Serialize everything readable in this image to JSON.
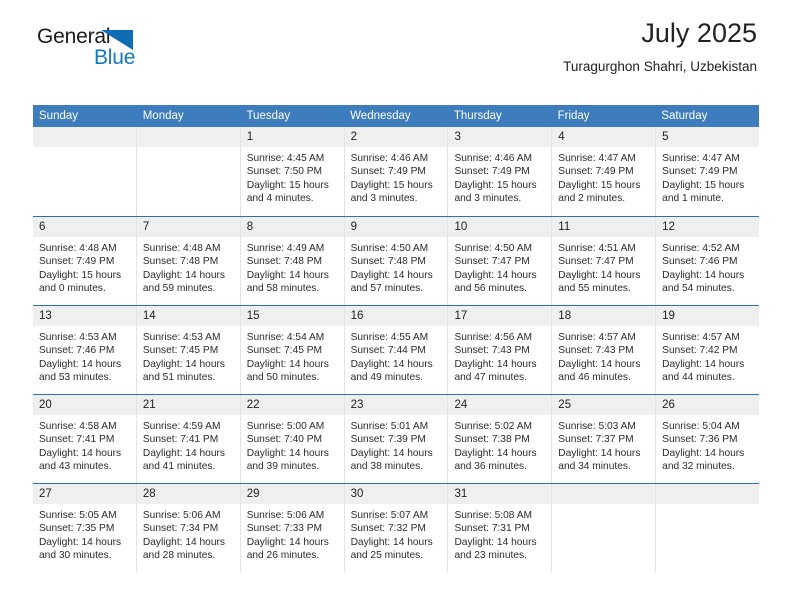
{
  "logo": {
    "word1": "General",
    "word2": "Blue",
    "triangle_color": "#0f6cb5",
    "text_color": "#1b1b1b",
    "blue_color": "#127cc1"
  },
  "header": {
    "title": "July 2025",
    "subtitle": "Turagurghon Shahri, Uzbekistan"
  },
  "theme": {
    "header_bar": "#3d7cbd",
    "week_separator": "#2f6fb0",
    "daynum_band": "#efefef"
  },
  "calendar": {
    "weekday_headers": [
      "Sunday",
      "Monday",
      "Tuesday",
      "Wednesday",
      "Thursday",
      "Friday",
      "Saturday"
    ],
    "weeks": [
      [
        {
          "day": "",
          "lines": []
        },
        {
          "day": "",
          "lines": []
        },
        {
          "day": "1",
          "lines": [
            "Sunrise: 4:45 AM",
            "Sunset: 7:50 PM",
            "Daylight: 15 hours and 4 minutes."
          ]
        },
        {
          "day": "2",
          "lines": [
            "Sunrise: 4:46 AM",
            "Sunset: 7:49 PM",
            "Daylight: 15 hours and 3 minutes."
          ]
        },
        {
          "day": "3",
          "lines": [
            "Sunrise: 4:46 AM",
            "Sunset: 7:49 PM",
            "Daylight: 15 hours and 3 minutes."
          ]
        },
        {
          "day": "4",
          "lines": [
            "Sunrise: 4:47 AM",
            "Sunset: 7:49 PM",
            "Daylight: 15 hours and 2 minutes."
          ]
        },
        {
          "day": "5",
          "lines": [
            "Sunrise: 4:47 AM",
            "Sunset: 7:49 PM",
            "Daylight: 15 hours and 1 minute."
          ]
        }
      ],
      [
        {
          "day": "6",
          "lines": [
            "Sunrise: 4:48 AM",
            "Sunset: 7:49 PM",
            "Daylight: 15 hours and 0 minutes."
          ]
        },
        {
          "day": "7",
          "lines": [
            "Sunrise: 4:48 AM",
            "Sunset: 7:48 PM",
            "Daylight: 14 hours and 59 minutes."
          ]
        },
        {
          "day": "8",
          "lines": [
            "Sunrise: 4:49 AM",
            "Sunset: 7:48 PM",
            "Daylight: 14 hours and 58 minutes."
          ]
        },
        {
          "day": "9",
          "lines": [
            "Sunrise: 4:50 AM",
            "Sunset: 7:48 PM",
            "Daylight: 14 hours and 57 minutes."
          ]
        },
        {
          "day": "10",
          "lines": [
            "Sunrise: 4:50 AM",
            "Sunset: 7:47 PM",
            "Daylight: 14 hours and 56 minutes."
          ]
        },
        {
          "day": "11",
          "lines": [
            "Sunrise: 4:51 AM",
            "Sunset: 7:47 PM",
            "Daylight: 14 hours and 55 minutes."
          ]
        },
        {
          "day": "12",
          "lines": [
            "Sunrise: 4:52 AM",
            "Sunset: 7:46 PM",
            "Daylight: 14 hours and 54 minutes."
          ]
        }
      ],
      [
        {
          "day": "13",
          "lines": [
            "Sunrise: 4:53 AM",
            "Sunset: 7:46 PM",
            "Daylight: 14 hours and 53 minutes."
          ]
        },
        {
          "day": "14",
          "lines": [
            "Sunrise: 4:53 AM",
            "Sunset: 7:45 PM",
            "Daylight: 14 hours and 51 minutes."
          ]
        },
        {
          "day": "15",
          "lines": [
            "Sunrise: 4:54 AM",
            "Sunset: 7:45 PM",
            "Daylight: 14 hours and 50 minutes."
          ]
        },
        {
          "day": "16",
          "lines": [
            "Sunrise: 4:55 AM",
            "Sunset: 7:44 PM",
            "Daylight: 14 hours and 49 minutes."
          ]
        },
        {
          "day": "17",
          "lines": [
            "Sunrise: 4:56 AM",
            "Sunset: 7:43 PM",
            "Daylight: 14 hours and 47 minutes."
          ]
        },
        {
          "day": "18",
          "lines": [
            "Sunrise: 4:57 AM",
            "Sunset: 7:43 PM",
            "Daylight: 14 hours and 46 minutes."
          ]
        },
        {
          "day": "19",
          "lines": [
            "Sunrise: 4:57 AM",
            "Sunset: 7:42 PM",
            "Daylight: 14 hours and 44 minutes."
          ]
        }
      ],
      [
        {
          "day": "20",
          "lines": [
            "Sunrise: 4:58 AM",
            "Sunset: 7:41 PM",
            "Daylight: 14 hours and 43 minutes."
          ]
        },
        {
          "day": "21",
          "lines": [
            "Sunrise: 4:59 AM",
            "Sunset: 7:41 PM",
            "Daylight: 14 hours and 41 minutes."
          ]
        },
        {
          "day": "22",
          "lines": [
            "Sunrise: 5:00 AM",
            "Sunset: 7:40 PM",
            "Daylight: 14 hours and 39 minutes."
          ]
        },
        {
          "day": "23",
          "lines": [
            "Sunrise: 5:01 AM",
            "Sunset: 7:39 PM",
            "Daylight: 14 hours and 38 minutes."
          ]
        },
        {
          "day": "24",
          "lines": [
            "Sunrise: 5:02 AM",
            "Sunset: 7:38 PM",
            "Daylight: 14 hours and 36 minutes."
          ]
        },
        {
          "day": "25",
          "lines": [
            "Sunrise: 5:03 AM",
            "Sunset: 7:37 PM",
            "Daylight: 14 hours and 34 minutes."
          ]
        },
        {
          "day": "26",
          "lines": [
            "Sunrise: 5:04 AM",
            "Sunset: 7:36 PM",
            "Daylight: 14 hours and 32 minutes."
          ]
        }
      ],
      [
        {
          "day": "27",
          "lines": [
            "Sunrise: 5:05 AM",
            "Sunset: 7:35 PM",
            "Daylight: 14 hours and 30 minutes."
          ]
        },
        {
          "day": "28",
          "lines": [
            "Sunrise: 5:06 AM",
            "Sunset: 7:34 PM",
            "Daylight: 14 hours and 28 minutes."
          ]
        },
        {
          "day": "29",
          "lines": [
            "Sunrise: 5:06 AM",
            "Sunset: 7:33 PM",
            "Daylight: 14 hours and 26 minutes."
          ]
        },
        {
          "day": "30",
          "lines": [
            "Sunrise: 5:07 AM",
            "Sunset: 7:32 PM",
            "Daylight: 14 hours and 25 minutes."
          ]
        },
        {
          "day": "31",
          "lines": [
            "Sunrise: 5:08 AM",
            "Sunset: 7:31 PM",
            "Daylight: 14 hours and 23 minutes."
          ]
        },
        {
          "day": "",
          "lines": []
        },
        {
          "day": "",
          "lines": []
        }
      ]
    ]
  }
}
